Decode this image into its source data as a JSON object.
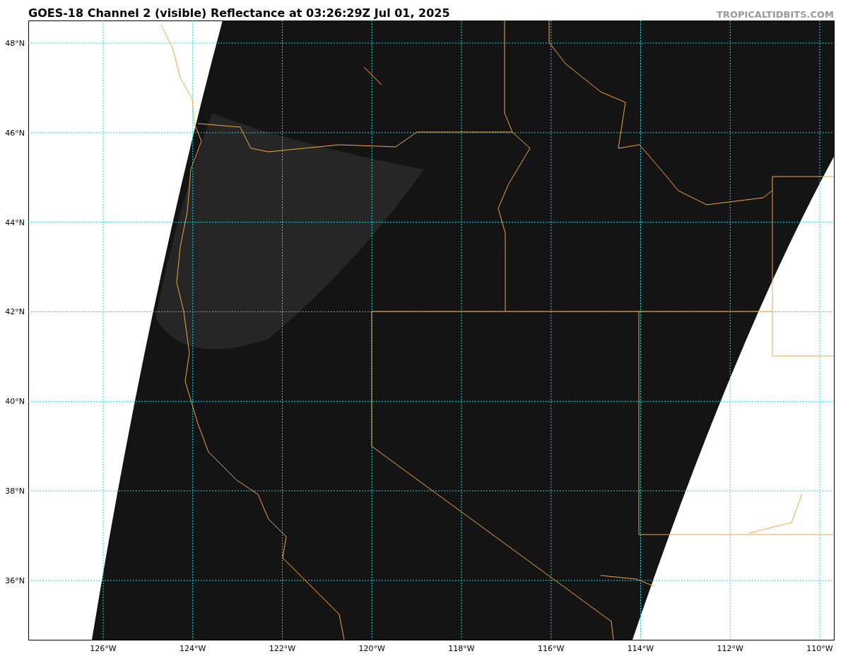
{
  "title": "GOES-18 Channel 2 (visible) Reflectance at 03:26:29Z Jul 01, 2025",
  "site": "TROPICALTIDBITS.COM",
  "map": {
    "x_labels": [
      "126°W",
      "124°W",
      "122°W",
      "120°W",
      "118°W",
      "116°W",
      "114°W",
      "112°W",
      "110°W"
    ],
    "y_labels": [
      "48°N",
      "46°N",
      "44°N",
      "42°N",
      "40°N",
      "38°N",
      "36°N"
    ]
  }
}
